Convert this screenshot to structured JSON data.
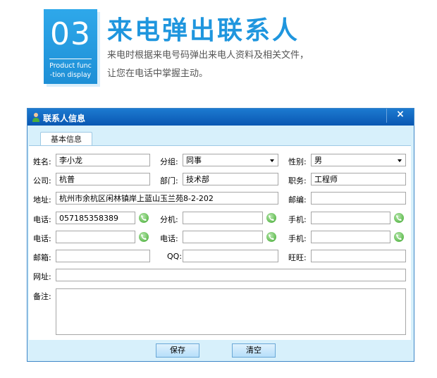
{
  "header": {
    "badge_number": "03",
    "badge_sub_line1": "Product func",
    "badge_sub_line2": "-tion display",
    "title": "来电弹出联系人",
    "desc_line1": "来电时根据来电号码弹出来电人资料及相关文件，",
    "desc_line2": "让您在电话中掌握主动。"
  },
  "window": {
    "title": "联系人信息",
    "close": "×",
    "tab": "基本信息"
  },
  "form": {
    "name_label": "姓名:",
    "name_value": "李小龙",
    "group_label": "分组:",
    "group_value": "同事",
    "gender_label": "性别:",
    "gender_value": "男",
    "company_label": "公司:",
    "company_value": "杭普",
    "dept_label": "部门:",
    "dept_value": "技术部",
    "position_label": "职务:",
    "position_value": "工程师",
    "address_label": "地址:",
    "address_value": "杭州市余杭区闲林镇岸上蓝山玉兰苑8-2-202",
    "postcode_label": "邮编:",
    "postcode_value": "",
    "phone1_label": "电话:",
    "phone1_value": "057185358389",
    "ext1_label": "分机:",
    "ext1_value": "",
    "mobile1_label": "手机:",
    "mobile1_value": "",
    "phone2_label": "电话:",
    "phone2_value": "",
    "phone3_label": "电话:",
    "phone3_value": "",
    "mobile2_label": "手机:",
    "mobile2_value": "",
    "email_label": "邮箱:",
    "email_value": "",
    "qq_label": "QQ:",
    "qq_value": "",
    "wangwang_label": "旺旺:",
    "wangwang_value": "",
    "website_label": "网址:",
    "website_value": "",
    "notes_label": "备注:",
    "notes_value": ""
  },
  "buttons": {
    "save": "保存",
    "clear": "清空"
  },
  "colors": {
    "accent": "#1f96de",
    "titlebar": "#0a57b2",
    "window_bg": "#d7f0fb",
    "phone_green": "#6cc25d"
  }
}
